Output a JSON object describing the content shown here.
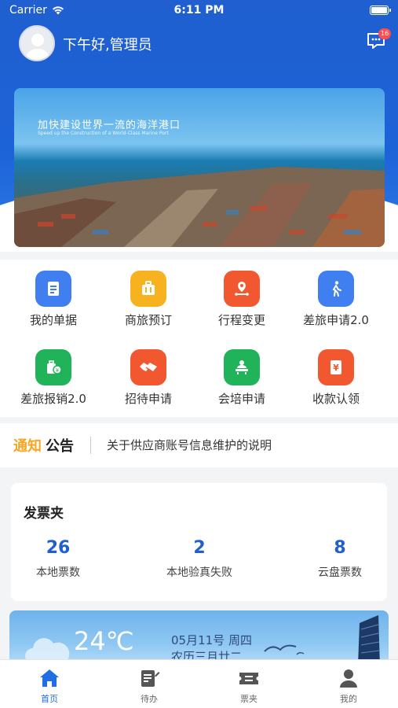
{
  "status_bar": {
    "carrier": "Carrier",
    "time": "6:11 PM"
  },
  "header": {
    "greeting": "下午好,管理员",
    "message_badge": "16"
  },
  "banner": {
    "title": "加快建设世界一流的海洋港口",
    "subtitle": "Speed up the Construction of a World-Class Marine Port"
  },
  "shortcuts": [
    {
      "label": "我的单据",
      "icon": "document-icon",
      "color": "#3f7ff0"
    },
    {
      "label": "商旅预订",
      "icon": "suitcase-icon",
      "color": "#f7b21f"
    },
    {
      "label": "行程变更",
      "icon": "location-route-icon",
      "color": "#f2582f"
    },
    {
      "label": "差旅申请2.0",
      "icon": "walking-person-icon",
      "color": "#3f7ff0"
    },
    {
      "label": "差旅报销2.0",
      "icon": "luggage-money-icon",
      "color": "#21b35a"
    },
    {
      "label": "招待申请",
      "icon": "handshake-icon",
      "color": "#f2582f"
    },
    {
      "label": "会培申请",
      "icon": "meeting-icon",
      "color": "#21b35a"
    },
    {
      "label": "收款认领",
      "icon": "yen-receipt-icon",
      "color": "#f2582f"
    }
  ],
  "notice": {
    "label_part1": "通知",
    "label_part2": "公告",
    "text": "关于供应商账号信息维护的说明"
  },
  "invoice_folder": {
    "title": "发票夹",
    "stats": [
      {
        "value": "26",
        "label": "本地票数"
      },
      {
        "value": "2",
        "label": "本地验真失败"
      },
      {
        "value": "8",
        "label": "云盘票数"
      }
    ]
  },
  "weather": {
    "temperature": "24℃",
    "date": "05月11号 周四",
    "lunar": "农历三月廿二"
  },
  "tabbar": [
    {
      "label": "首页",
      "icon": "home-icon",
      "active": true
    },
    {
      "label": "待办",
      "icon": "todo-icon",
      "active": false
    },
    {
      "label": "票夹",
      "icon": "ticket-icon",
      "active": false
    },
    {
      "label": "我的",
      "icon": "user-icon",
      "active": false
    }
  ],
  "colors": {
    "primary": "#1f5fcf",
    "notice_accent": "#f6a623",
    "tab_active": "#1f6ee5"
  }
}
